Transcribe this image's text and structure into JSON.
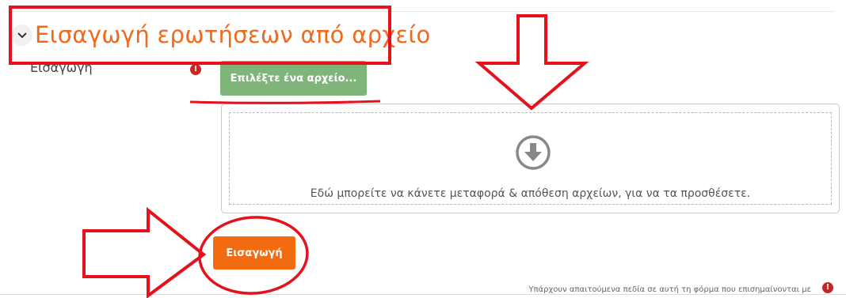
{
  "section": {
    "title": "Εισαγωγή ερωτήσεων από αρχείο",
    "toggle_icon": "chevron-down-icon"
  },
  "field": {
    "label": "Εισαγωγή",
    "required_icon": "!"
  },
  "filepicker": {
    "choose_label": "Επιλέξτε ένα αρχείο...",
    "drop_text": "Εδώ μπορείτε να κάνετε μεταφορά & απόθεση αρχείων, για να τα προσθέσετε.",
    "drop_icon": "download-arrow-icon"
  },
  "actions": {
    "import_label": "Εισαγωγή"
  },
  "footer": {
    "required_note": "Υπάρχουν απαιτούμενα πεδία σε αυτή τη φόρμα που επισημαίνονται με",
    "required_icon": "!"
  },
  "colors": {
    "accent": "#ef6a1d",
    "primary_button": "#f26b10",
    "file_button": "#7fb47b",
    "required": "#c62828",
    "annotation": "#e3121b"
  }
}
